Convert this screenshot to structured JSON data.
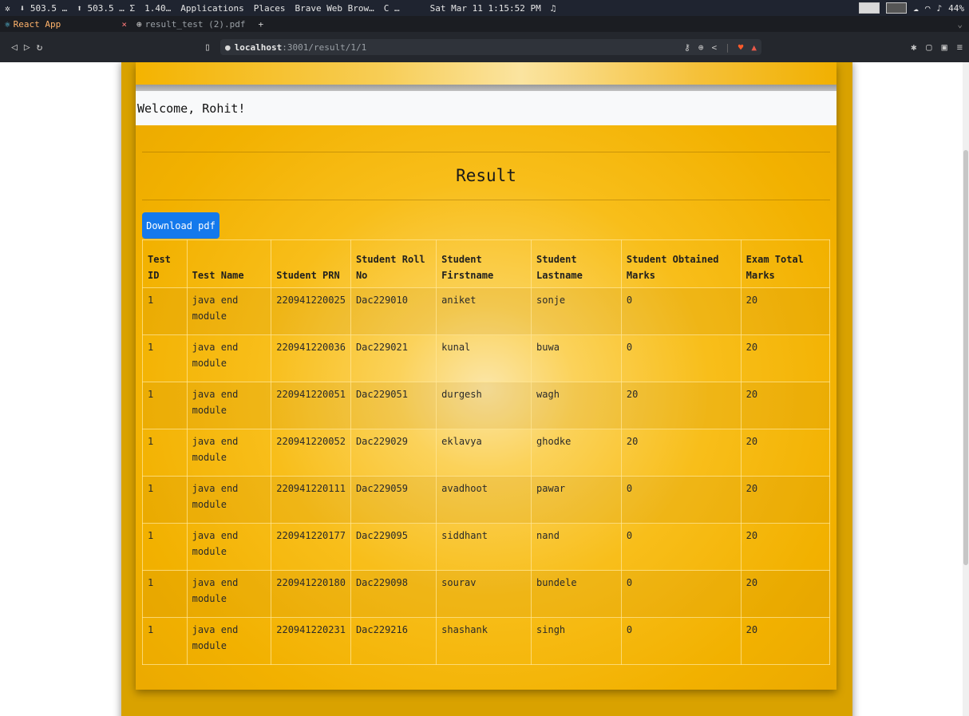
{
  "system_panel": {
    "items": [
      "⬇ 503.5 …",
      "⬆ 503.5 … Σ",
      "1.40…",
      "Applications",
      "Places",
      "Brave Web Brow…",
      "C …",
      "Sat Mar 11  1:15:52 PM"
    ],
    "battery": "44%"
  },
  "tabs": [
    {
      "label": "React App",
      "active": true
    },
    {
      "label": "result_test (2).pdf",
      "active": false
    }
  ],
  "browser": {
    "url_host": "localhost",
    "url_path": ":3001/result/1/1"
  },
  "page": {
    "welcome_text": "Welcome, Rohit!",
    "title": "Result",
    "download_label": "Download pdf"
  },
  "table": {
    "headers": [
      "Test ID",
      "Test Name",
      "Student PRN",
      "Student Roll No",
      "Student Firstname",
      "Student Lastname",
      "Student Obtained Marks",
      "Exam Total Marks"
    ],
    "rows": [
      [
        "1",
        "java end module",
        "220941220025",
        "Dac229010",
        "aniket",
        "sonje",
        "0",
        "20"
      ],
      [
        "1",
        "java end module",
        "220941220036",
        "Dac229021",
        "kunal",
        "buwa",
        "0",
        "20"
      ],
      [
        "1",
        "java end module",
        "220941220051",
        "Dac229051",
        "durgesh",
        "wagh",
        "20",
        "20"
      ],
      [
        "1",
        "java end module",
        "220941220052",
        "Dac229029",
        "eklavya",
        "ghodke",
        "20",
        "20"
      ],
      [
        "1",
        "java end module",
        "220941220111",
        "Dac229059",
        "avadhoot",
        "pawar",
        "0",
        "20"
      ],
      [
        "1",
        "java end module",
        "220941220177",
        "Dac229095",
        "siddhant",
        "nand",
        "0",
        "20"
      ],
      [
        "1",
        "java end module",
        "220941220180",
        "Dac229098",
        "sourav",
        "bundele",
        "0",
        "20"
      ],
      [
        "1",
        "java end module",
        "220941220231",
        "Dac229216",
        "shashank",
        "singh",
        "0",
        "20"
      ]
    ]
  }
}
